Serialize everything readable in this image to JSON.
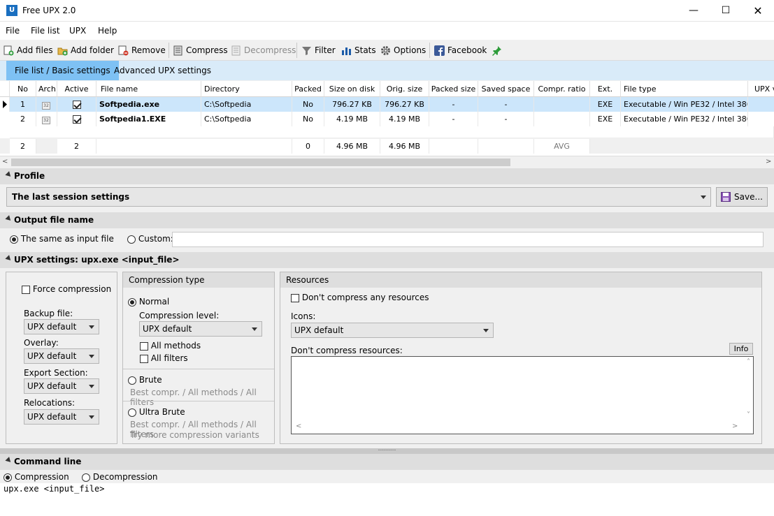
{
  "window": {
    "title": "Free UPX 2.0",
    "icon_letter": "U",
    "controls": [
      "minimize-icon",
      "maximize-icon",
      "close-icon"
    ]
  },
  "menu": [
    "File",
    "File list",
    "UPX",
    "Help"
  ],
  "toolbar": {
    "add_files": "Add files",
    "add_folder": "Add folder",
    "remove": "Remove",
    "compress": "Compress",
    "decompress": "Decompress",
    "filter": "Filter",
    "stats": "Stats",
    "options": "Options",
    "facebook": "Facebook"
  },
  "tabs": {
    "basic": "File list / Basic settings",
    "advanced": "Advanced UPX settings"
  },
  "grid": {
    "headers": [
      "No",
      "Arch",
      "Active",
      "File name",
      "Directory",
      "Packed",
      "Size on disk",
      "Orig. size",
      "Packed size",
      "Saved space",
      "Compr. ratio",
      "Ext.",
      "File type",
      "UPX v"
    ],
    "rows": [
      {
        "no": "1",
        "arch": "32",
        "active": true,
        "name": "Softpedia.exe",
        "dir": "C:\\Softpedia",
        "packed": "No",
        "size": "796.27 KB",
        "orig": "796.27 KB",
        "packed_size": "-",
        "saved": "-",
        "ratio": "",
        "ext": "EXE",
        "type": "Executable / Win PE32 / Intel 386"
      },
      {
        "no": "2",
        "arch": "32",
        "active": true,
        "name": "Softpedia1.EXE",
        "dir": "C:\\Softpedia",
        "packed": "No",
        "size": "4.19 MB",
        "orig": "4.19 MB",
        "packed_size": "-",
        "saved": "-",
        "ratio": "",
        "ext": "EXE",
        "type": "Executable / Win PE32 / Intel 386"
      }
    ],
    "summary": {
      "no": "2",
      "active": "2",
      "packed": "0",
      "size": "4.96 MB",
      "orig": "4.96 MB",
      "ratio": "AVG"
    }
  },
  "profile": {
    "section": "Profile",
    "value": "The  last  session  settings",
    "save": "Save..."
  },
  "output": {
    "section": "Output file name",
    "same": "The same as input file",
    "custom": "Custom:",
    "custom_value": ""
  },
  "upx": {
    "section": "UPX settings:   upx.exe <input_file>",
    "force": "Force compression",
    "backup_label": "Backup file:",
    "backup": "UPX default",
    "overlay_label": "Overlay:",
    "overlay": "UPX default",
    "export_label": "Export Section:",
    "export": "UPX default",
    "reloc_label": "Relocations:",
    "reloc": "UPX default",
    "ctype": "Compression type",
    "normal": "Normal",
    "level_label": "Compression level:",
    "level": "UPX default",
    "all_methods": "All methods",
    "all_filters": "All filters",
    "brute": "Brute",
    "brute_desc": "Best compr. / All methods / All filters",
    "ultra": "Ultra Brute",
    "ultra_desc1": "Best compr. / All methods / All filters",
    "ultra_desc2": "Try more compression variants",
    "resources": "Resources",
    "no_res": "Don't compress any resources",
    "icons_label": "Icons:",
    "icons": "UPX default",
    "dont_res": "Don't compress resources:",
    "info": "Info"
  },
  "cmd": {
    "section": "Command line",
    "compression": "Compression",
    "decompression": "Decompression",
    "text": "upx.exe <input_file>"
  },
  "splitter": "........."
}
